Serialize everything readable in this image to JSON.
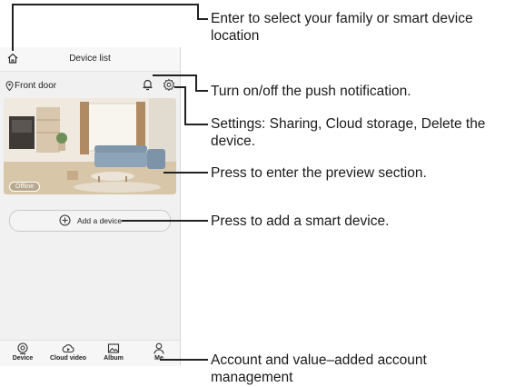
{
  "phone": {
    "header_title": "Device list",
    "device_name": "Front door",
    "offline_label": "Offline",
    "add_device_label": "Add a device",
    "tabs": [
      {
        "label": "Device",
        "icon": "device-icon"
      },
      {
        "label": "Cloud video",
        "icon": "cloud-video-icon"
      },
      {
        "label": "Album",
        "icon": "album-icon"
      },
      {
        "label": "Me",
        "icon": "person-icon"
      }
    ]
  },
  "annotations": {
    "location": "Enter to select your family or smart device location",
    "notification": "Turn on/off the push notification.",
    "settings": "Settings: Sharing, Cloud storage, Delete the device.",
    "preview": "Press to enter the preview section.",
    "add_device": "Press to add a smart device.",
    "account": "Account and value–added account management"
  }
}
